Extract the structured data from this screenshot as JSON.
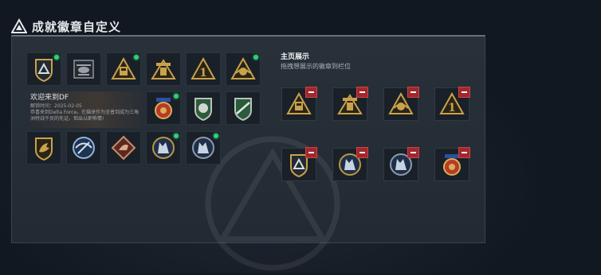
{
  "header": {
    "title": "成就徽章自定义"
  },
  "collection": {
    "badges": [
      {
        "icon": "shield-triangle-badge-icon",
        "new": true
      },
      {
        "icon": "helicopter-badge-icon",
        "new": false
      },
      {
        "icon": "robot-triangle-badge-icon",
        "new": true
      },
      {
        "icon": "mech-triangle-badge-icon",
        "new": false
      },
      {
        "icon": "number-one-triangle-badge-icon",
        "new": false
      },
      {
        "icon": "warrior-triangle-badge-icon",
        "new": true
      },
      {
        "icon": "medal-crown-badge-icon",
        "new": true
      },
      {
        "icon": "green-shield-badge-icon",
        "new": false
      },
      {
        "icon": "rifle-shield-badge-icon",
        "new": false
      },
      {
        "icon": "dino-shield-badge-icon",
        "new": false
      },
      {
        "icon": "blue-wings-badge-icon",
        "new": false
      },
      {
        "icon": "red-diamond-badge-icon",
        "new": false
      },
      {
        "icon": "blue-wolf-round-badge-icon",
        "new": true
      },
      {
        "icon": "blue-wolf-round-badge-icon",
        "new": true
      }
    ],
    "info": {
      "title": "欢迎来到DF",
      "date": "解锁时间：2025-02-05",
      "desc": "恭喜来到Delta Force。在猫来作为坐普到成为三角洲特战干员的先证。但出以即佈情!"
    }
  },
  "showcase": {
    "title": "主页展示",
    "subtitle": "拖拽想展示的徽章到栏位",
    "slots": [
      {
        "icon": "robot-triangle-badge-icon"
      },
      {
        "icon": "mech-triangle-badge-icon"
      },
      {
        "icon": "warrior-triangle-badge-icon"
      },
      {
        "icon": "number-one-triangle-badge-icon"
      },
      {
        "icon": "shield-triangle-badge-icon"
      },
      {
        "icon": "blue-wolf-round-badge-icon"
      },
      {
        "icon": "blue-wolf-round-badge-icon"
      },
      {
        "icon": "medal-crown-badge-icon"
      }
    ]
  },
  "colors": {
    "gold": "#c9a24a",
    "dark": "#1a2028",
    "green": "#2fd07a",
    "remove": "#a0282d"
  }
}
